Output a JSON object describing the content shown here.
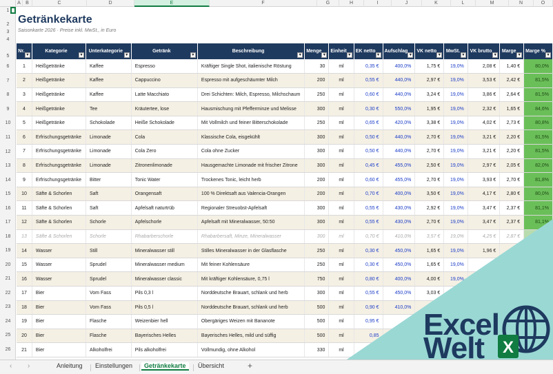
{
  "columns": [
    "A",
    "B",
    "C",
    "D",
    "E",
    "F",
    "G",
    "H",
    "I",
    "J",
    "K",
    "L",
    "M",
    "N",
    "O"
  ],
  "rows": [
    "1",
    "2",
    "3",
    "4",
    "5",
    "6",
    "7",
    "8",
    "9",
    "10",
    "11",
    "12",
    "13",
    "14",
    "15",
    "16",
    "17",
    "18",
    "19",
    "20",
    "21",
    "22",
    "23",
    "24",
    "25",
    "26"
  ],
  "sheet": {
    "title": "Getränkekarte",
    "subtitle": "Saisonkarte 2026 · Preise inkl. MwSt., in Euro"
  },
  "headers": [
    "Nr.",
    "Kategorie",
    "Unterkategorie",
    "Getränk",
    "Beschreibung",
    "Menge",
    "Einheit",
    "EK netto",
    "Aufschlag",
    "VK netto",
    "MwSt.",
    "VK brutto",
    "Marge",
    "Marge %"
  ],
  "table": [
    [
      "1",
      "Heißgetränke",
      "Kaffee",
      "Espresso",
      "Kräftiger Single Shot, italienische Röstung",
      "30",
      "ml",
      "0,35 €",
      "400,0%",
      "1,75 €",
      "19,0%",
      "2,08 €",
      "1,40 €",
      "80,0%"
    ],
    [
      "2",
      "Heißgetränke",
      "Kaffee",
      "Cappuccino",
      "Espresso mit aufgeschäumter Milch",
      "200",
      "ml",
      "0,55 €",
      "440,0%",
      "2,97 €",
      "19,0%",
      "3,53 €",
      "2,42 €",
      "81,5%"
    ],
    [
      "3",
      "Heißgetränke",
      "Kaffee",
      "Latte Macchiato",
      "Drei Schichten: Milch, Espresso, Milchschaum",
      "250",
      "ml",
      "0,60 €",
      "440,0%",
      "3,24 €",
      "19,0%",
      "3,86 €",
      "2,64 €",
      "81,5%"
    ],
    [
      "4",
      "Heißgetränke",
      "Tee",
      "Kräutertee, lose",
      "Hausmischung mit Pfefferminze und Melisse",
      "300",
      "ml",
      "0,30 €",
      "550,0%",
      "1,95 €",
      "19,0%",
      "2,32 €",
      "1,65 €",
      "84,6%"
    ],
    [
      "5",
      "Heißgetränke",
      "Schokolade",
      "Heiße Schokolade",
      "Mit Vollmilch und feiner Bitterschokolade",
      "250",
      "ml",
      "0,65 €",
      "420,0%",
      "3,38 €",
      "19,0%",
      "4,02 €",
      "2,73 €",
      "80,8%"
    ],
    [
      "6",
      "Erfrischungsgetränke",
      "Limonade",
      "Cola",
      "Klassische Cola, eisgekühlt",
      "300",
      "ml",
      "0,50 €",
      "440,0%",
      "2,70 €",
      "19,0%",
      "3,21 €",
      "2,20 €",
      "81,5%"
    ],
    [
      "7",
      "Erfrischungsgetränke",
      "Limonade",
      "Cola Zero",
      "Cola ohne Zucker",
      "300",
      "ml",
      "0,50 €",
      "440,0%",
      "2,70 €",
      "19,0%",
      "3,21 €",
      "2,20 €",
      "81,5%"
    ],
    [
      "8",
      "Erfrischungsgetränke",
      "Limonade",
      "Zitronenlimonade",
      "Hausgemachte Limonade mit frischer Zitrone",
      "300",
      "ml",
      "0,45 €",
      "455,0%",
      "2,50 €",
      "19,0%",
      "2,97 €",
      "2,05 €",
      "82,0%"
    ],
    [
      "9",
      "Erfrischungsgetränke",
      "Bitter",
      "Tonic Water",
      "Trockenes Tonic, leicht herb",
      "200",
      "ml",
      "0,60 €",
      "455,0%",
      "2,70 €",
      "19,0%",
      "3,93 €",
      "2,70 €",
      "81,8%"
    ],
    [
      "10",
      "Säfte & Schorlen",
      "Saft",
      "Orangensaft",
      "100 % Direktsaft aus Valencia-Orangen",
      "200",
      "ml",
      "0,70 €",
      "400,0%",
      "3,50 €",
      "19,0%",
      "4,17 €",
      "2,80 €",
      "80,0%"
    ],
    [
      "11",
      "Säfte & Schorlen",
      "Saft",
      "Apfelsaft naturtrüb",
      "Regionaler Streuobst-Apfelsaft",
      "300",
      "ml",
      "0,55 €",
      "430,0%",
      "2,92 €",
      "19,0%",
      "3,47 €",
      "2,37 €",
      "81,1%"
    ],
    [
      "12",
      "Säfte & Schorlen",
      "Schorle",
      "Apfelschorle",
      "Apfelsaft mit Mineralwasser, 50:50",
      "300",
      "ml",
      "0,55 €",
      "430,0%",
      "2,70 €",
      "19,0%",
      "3,47 €",
      "2,37 €",
      "81,1%"
    ],
    [
      "13",
      "Säfte & Schorlen",
      "Schorle",
      "Rhabarberschorle",
      "Rhabarbersaft, Minze, Mineralwasser",
      "300",
      "ml",
      "0,70 €",
      "410,0%",
      "3,57 €",
      "19,0%",
      "4,25 €",
      "2,87 €",
      ""
    ],
    [
      "14",
      "Wasser",
      "Still",
      "Mineralwasser still",
      "Stilles Mineralwasser in der Glasflasche",
      "250",
      "ml",
      "0,30 €",
      "450,0%",
      "1,65 €",
      "19,0%",
      "1,96 €",
      "",
      ""
    ],
    [
      "15",
      "Wasser",
      "Sprudel",
      "Mineralwasser medium",
      "Mit feiner Kohlensäure",
      "250",
      "ml",
      "0,30 €",
      "450,0%",
      "1,65 €",
      "19,0%",
      "",
      "",
      ""
    ],
    [
      "16",
      "Wasser",
      "Sprudel",
      "Mineralwasser classic",
      "Mit kräftiger Kohlensäure, 0,75 l",
      "750",
      "ml",
      "0,80 €",
      "400,0%",
      "4,00 €",
      "19,0%",
      "",
      "",
      ""
    ],
    [
      "17",
      "Bier",
      "Vom Fass",
      "Pils 0,3 l",
      "Norddeutsche Brauart, schlank und herb",
      "300",
      "ml",
      "0,55 €",
      "450,0%",
      "3,03 €",
      "",
      "",
      "",
      ""
    ],
    [
      "18",
      "Bier",
      "Vom Fass",
      "Pils 0,5 l",
      "Norddeutsche Brauart, schlank und herb",
      "500",
      "ml",
      "0,90 €",
      "410,0%",
      "",
      "",
      "",
      "",
      ""
    ],
    [
      "19",
      "Bier",
      "Flasche",
      "Weizenbier hell",
      "Obergäriges Weizen mit Bananote",
      "500",
      "ml",
      "0,95 €",
      "41",
      "",
      "",
      "",
      "",
      ""
    ],
    [
      "20",
      "Bier",
      "Flasche",
      "Bayerisches Helles",
      "Bayerisches Helles, mild und süffig",
      "500",
      "ml",
      "0,85",
      "",
      "",
      "",
      "",
      "",
      ""
    ],
    [
      "21",
      "Bier",
      "Alkoholfrei",
      "Pils alkoholfrei",
      "Vollmundig, ohne Alkohol",
      "330",
      "ml",
      "",
      "",
      "",
      "",
      "",
      "",
      ""
    ]
  ],
  "tabs": {
    "t1": "Anleitung",
    "t2": "Einstellungen",
    "t3": "Getränkekarte",
    "t4": "Übersicht",
    "add": "+",
    "prev": "‹",
    "next": "›"
  },
  "logo": {
    "line1": "Excel",
    "line2": "Welt",
    "badge": "X",
    "accent": "#9ad8d4",
    "brand": "#1e3a5f",
    "excel_green": "#107c41"
  },
  "colors": {
    "header_bg": "#1f3a5f",
    "alt_row": "#f5f0e4",
    "margin_green": "#6bbf59",
    "link_blue": "#1a3cc7"
  }
}
